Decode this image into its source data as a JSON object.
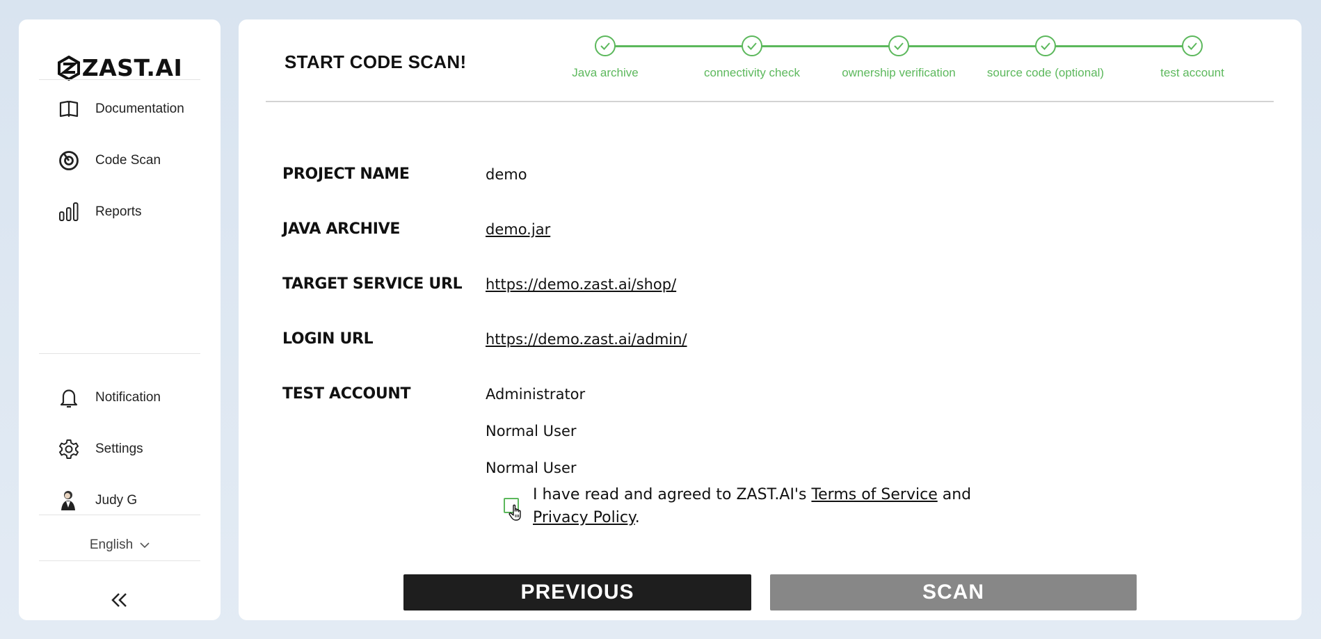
{
  "brand": {
    "logo_text": "ZAST.AI"
  },
  "sidebar": {
    "top_items": [
      {
        "label": "Documentation",
        "icon": "book-icon"
      },
      {
        "label": "Code Scan",
        "icon": "scan-target-icon"
      },
      {
        "label": "Reports",
        "icon": "bar-chart-icon"
      }
    ],
    "bottom_items": [
      {
        "label": "Notification",
        "icon": "bell-icon"
      },
      {
        "label": "Settings",
        "icon": "gear-icon"
      },
      {
        "label": "Judy G",
        "icon": "avatar"
      }
    ],
    "language": "English",
    "collapse_icon": "double-chevron-left-icon"
  },
  "header": {
    "title": "START CODE SCAN!"
  },
  "stepper": {
    "steps": [
      {
        "label": "Java archive",
        "status": "complete"
      },
      {
        "label": "connectivity check",
        "status": "complete"
      },
      {
        "label": "ownership verification",
        "status": "complete"
      },
      {
        "label": "source code (optional)",
        "status": "complete"
      },
      {
        "label": "test account",
        "status": "complete"
      }
    ],
    "accent_color": "#5cb85c"
  },
  "summary": {
    "project_name": {
      "label": "PROJECT NAME",
      "value": "demo"
    },
    "java_archive": {
      "label": "JAVA ARCHIVE",
      "value": "demo.jar"
    },
    "target_url": {
      "label": "TARGET SERVICE URL",
      "value": "https://demo.zast.ai/shop/"
    },
    "login_url": {
      "label": "LOGIN URL",
      "value": "https://demo.zast.ai/admin/"
    },
    "test_account": {
      "label": "TEST ACCOUNT",
      "values": [
        "Administrator",
        "Normal User",
        "Normal User"
      ]
    }
  },
  "agreement": {
    "checked": false,
    "prefix": "I have read and agreed to ZAST.AI's ",
    "terms_link": "Terms of Service",
    "middle": " and ",
    "privacy_link": "Privacy Policy",
    "suffix": "."
  },
  "actions": {
    "previous_label": "PREVIOUS",
    "scan_label": "SCAN"
  }
}
